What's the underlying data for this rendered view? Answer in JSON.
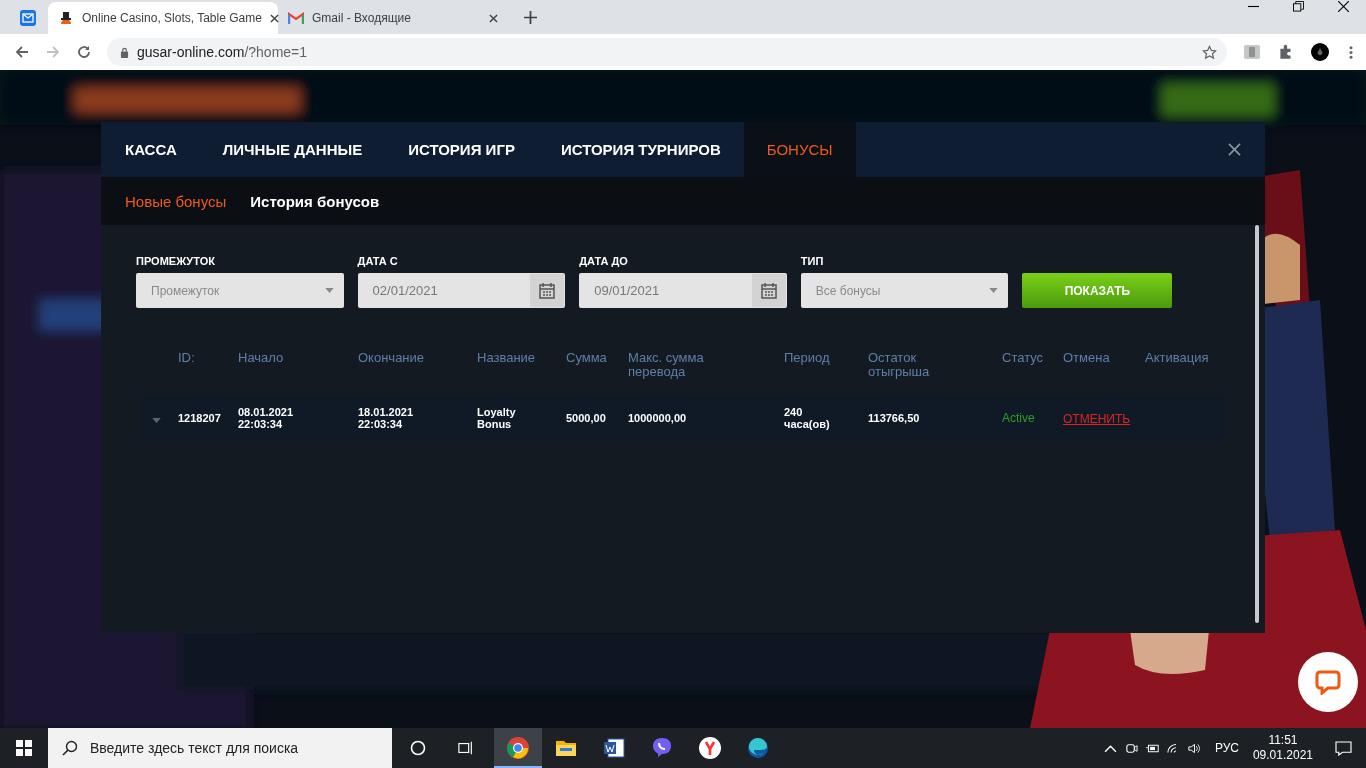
{
  "browser": {
    "tabs": [
      {
        "kind": "pinned",
        "selected": false
      },
      {
        "kind": "page",
        "title": "Online Casino, Slots, Table Game",
        "selected": true
      },
      {
        "kind": "page",
        "title": "Gmail - Входящие",
        "selected": false
      }
    ],
    "url_host": "gusar-online.com",
    "url_rest": "/?home=1"
  },
  "modal": {
    "tabs": [
      {
        "label": "КАССА",
        "selected": false
      },
      {
        "label": "ЛИЧНЫЕ ДАННЫЕ",
        "selected": false
      },
      {
        "label": "ИСТОРИЯ ИГР",
        "selected": false
      },
      {
        "label": "ИСТОРИЯ ТУРНИРОВ",
        "selected": false
      },
      {
        "label": "БОНУСЫ",
        "selected": true
      }
    ],
    "subtabs": [
      {
        "label": "Новые бонусы",
        "selected": true
      },
      {
        "label": "История бонусов",
        "selected": false
      }
    ],
    "filters": [
      {
        "kind": "select",
        "label": "ПРОМЕЖУТОК",
        "placeholder": "Промежуток"
      },
      {
        "kind": "date",
        "label": "ДАТА С",
        "value": "02/01/2021"
      },
      {
        "kind": "date",
        "label": "ДАТА ДО",
        "value": "09/01/2021"
      },
      {
        "kind": "select",
        "label": "ТИП",
        "value": "Все бонусы"
      }
    ],
    "show_button": "ПОКАЗАТЬ",
    "table": {
      "columns": [
        "ID:",
        "Начало",
        "Окончание",
        "Название",
        "Сумма",
        "Макс. сумма перевода",
        "Период",
        "Остаток отыгрыша",
        "Статус",
        "Отмена",
        "Активация"
      ],
      "rows": [
        {
          "id": "1218207",
          "start": "08.01.2021\n22:03:34",
          "end": "18.01.2021\n22:03:34",
          "name": "Loyalty\nBonus",
          "amount": "5000,00",
          "max_transfer": "1000000,00",
          "period": "240\nчаса(ов)",
          "remaining": "113766,50",
          "status": "Active",
          "cancel": "ОТМЕНИТЬ"
        }
      ]
    }
  },
  "taskbar": {
    "search_placeholder": "Введите здесь текст для поиска",
    "apps": [
      {
        "kind": "chrome",
        "selected": true
      },
      {
        "kind": "explorer",
        "selected": false
      },
      {
        "kind": "word",
        "selected": false
      },
      {
        "kind": "viber",
        "selected": false
      },
      {
        "kind": "yandex",
        "selected": false
      },
      {
        "kind": "edge",
        "selected": false
      }
    ],
    "language": "РУС",
    "time": "11:51",
    "date": "09.01.2021"
  }
}
